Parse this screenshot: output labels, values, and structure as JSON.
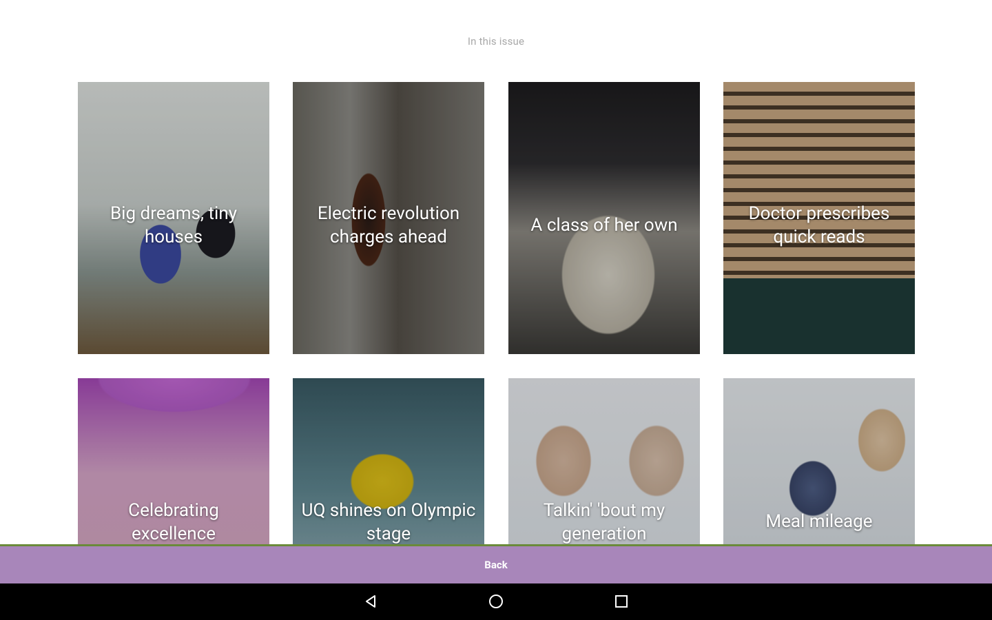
{
  "header": {
    "issue_heading": "In this issue"
  },
  "articles": [
    {
      "title": "Big dreams, tiny houses"
    },
    {
      "title": "Electric revolution charges ahead"
    },
    {
      "title": "A class of her own"
    },
    {
      "title": "Doctor prescribes quick reads"
    },
    {
      "title": "Celebrating excellence"
    },
    {
      "title": "UQ shines on Olympic stage"
    },
    {
      "title": "Talkin' 'bout my generation"
    },
    {
      "title": "Meal mileage"
    }
  ],
  "footer": {
    "back_label": "Back"
  },
  "navigation_bar": {
    "buttons": [
      "back-triangle-icon",
      "home-circle-icon",
      "recents-square-icon"
    ]
  },
  "colors": {
    "back_bar": "#a886ba",
    "back_bar_border": "#6a8a3a",
    "nav_bar": "#000000",
    "heading_text": "#a8a8a8"
  }
}
